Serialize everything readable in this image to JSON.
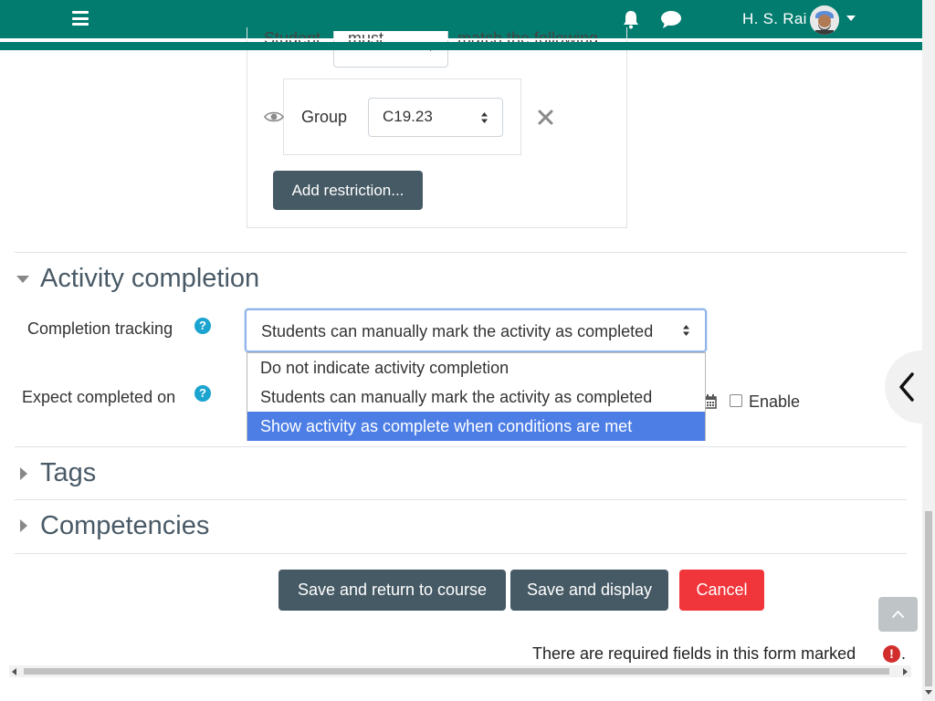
{
  "navbar": {
    "username": "H. S. Rai",
    "menu_icon": "hamburger-icon",
    "notification_icon": "bell-icon",
    "messages_icon": "chat-icon",
    "user_menu_icon": "caret-down-icon",
    "color": "#017c6e"
  },
  "restrictions": {
    "partial_text_student": "Student",
    "partial_select_value": "must",
    "partial_text_match": "match the following",
    "group_label": "Group",
    "group_value": "C19.23",
    "add_restriction_label": "Add restriction..."
  },
  "activity_completion": {
    "title": "Activity completion",
    "completion_tracking_label": "Completion tracking",
    "completion_tracking_value": "Students can manually mark the activity as completed",
    "options": [
      "Do not indicate activity completion",
      "Students can manually mark the activity as completed",
      "Show activity as complete when conditions are met"
    ],
    "highlighted_option_index": 2,
    "expect_completed_label": "Expect completed on",
    "enable_label": "Enable",
    "enable_checked": false
  },
  "sections": {
    "tags": "Tags",
    "competencies": "Competencies"
  },
  "actions": {
    "save_return": "Save and return to course",
    "save_display": "Save and display",
    "cancel": "Cancel"
  },
  "required_note": "There are required fields in this form marked",
  "required_icon": "!",
  "trailing_dot": ".",
  "colors": {
    "primary_dark": "#465a65",
    "danger": "#f0353b",
    "highlight": "#4c7ee6",
    "help": "#1aa4cf"
  }
}
